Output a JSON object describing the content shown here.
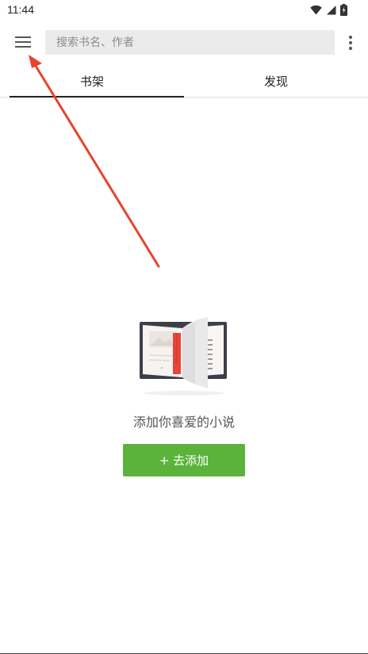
{
  "status_bar": {
    "time": "11:44",
    "icons": [
      "wifi-icon",
      "signal-icon",
      "battery-icon"
    ]
  },
  "toolbar": {
    "menu_icon": "hamburger-menu-icon",
    "search": {
      "placeholder": "搜索书名、作者",
      "value": ""
    },
    "more_icon": "more-vertical-icon"
  },
  "tabs": [
    {
      "label": "书架",
      "active": true
    },
    {
      "label": "发现",
      "active": false
    }
  ],
  "empty_state": {
    "illustration": "open-book-icon",
    "message": "添加你喜爱的小说",
    "button_icon": "plus-icon",
    "button_label": "+ 去添加"
  },
  "colors": {
    "accent_green": "#5bb33b",
    "annotation_red": "#e8432e",
    "bookmark_red": "#e8433a",
    "search_bg": "#ebebeb"
  }
}
